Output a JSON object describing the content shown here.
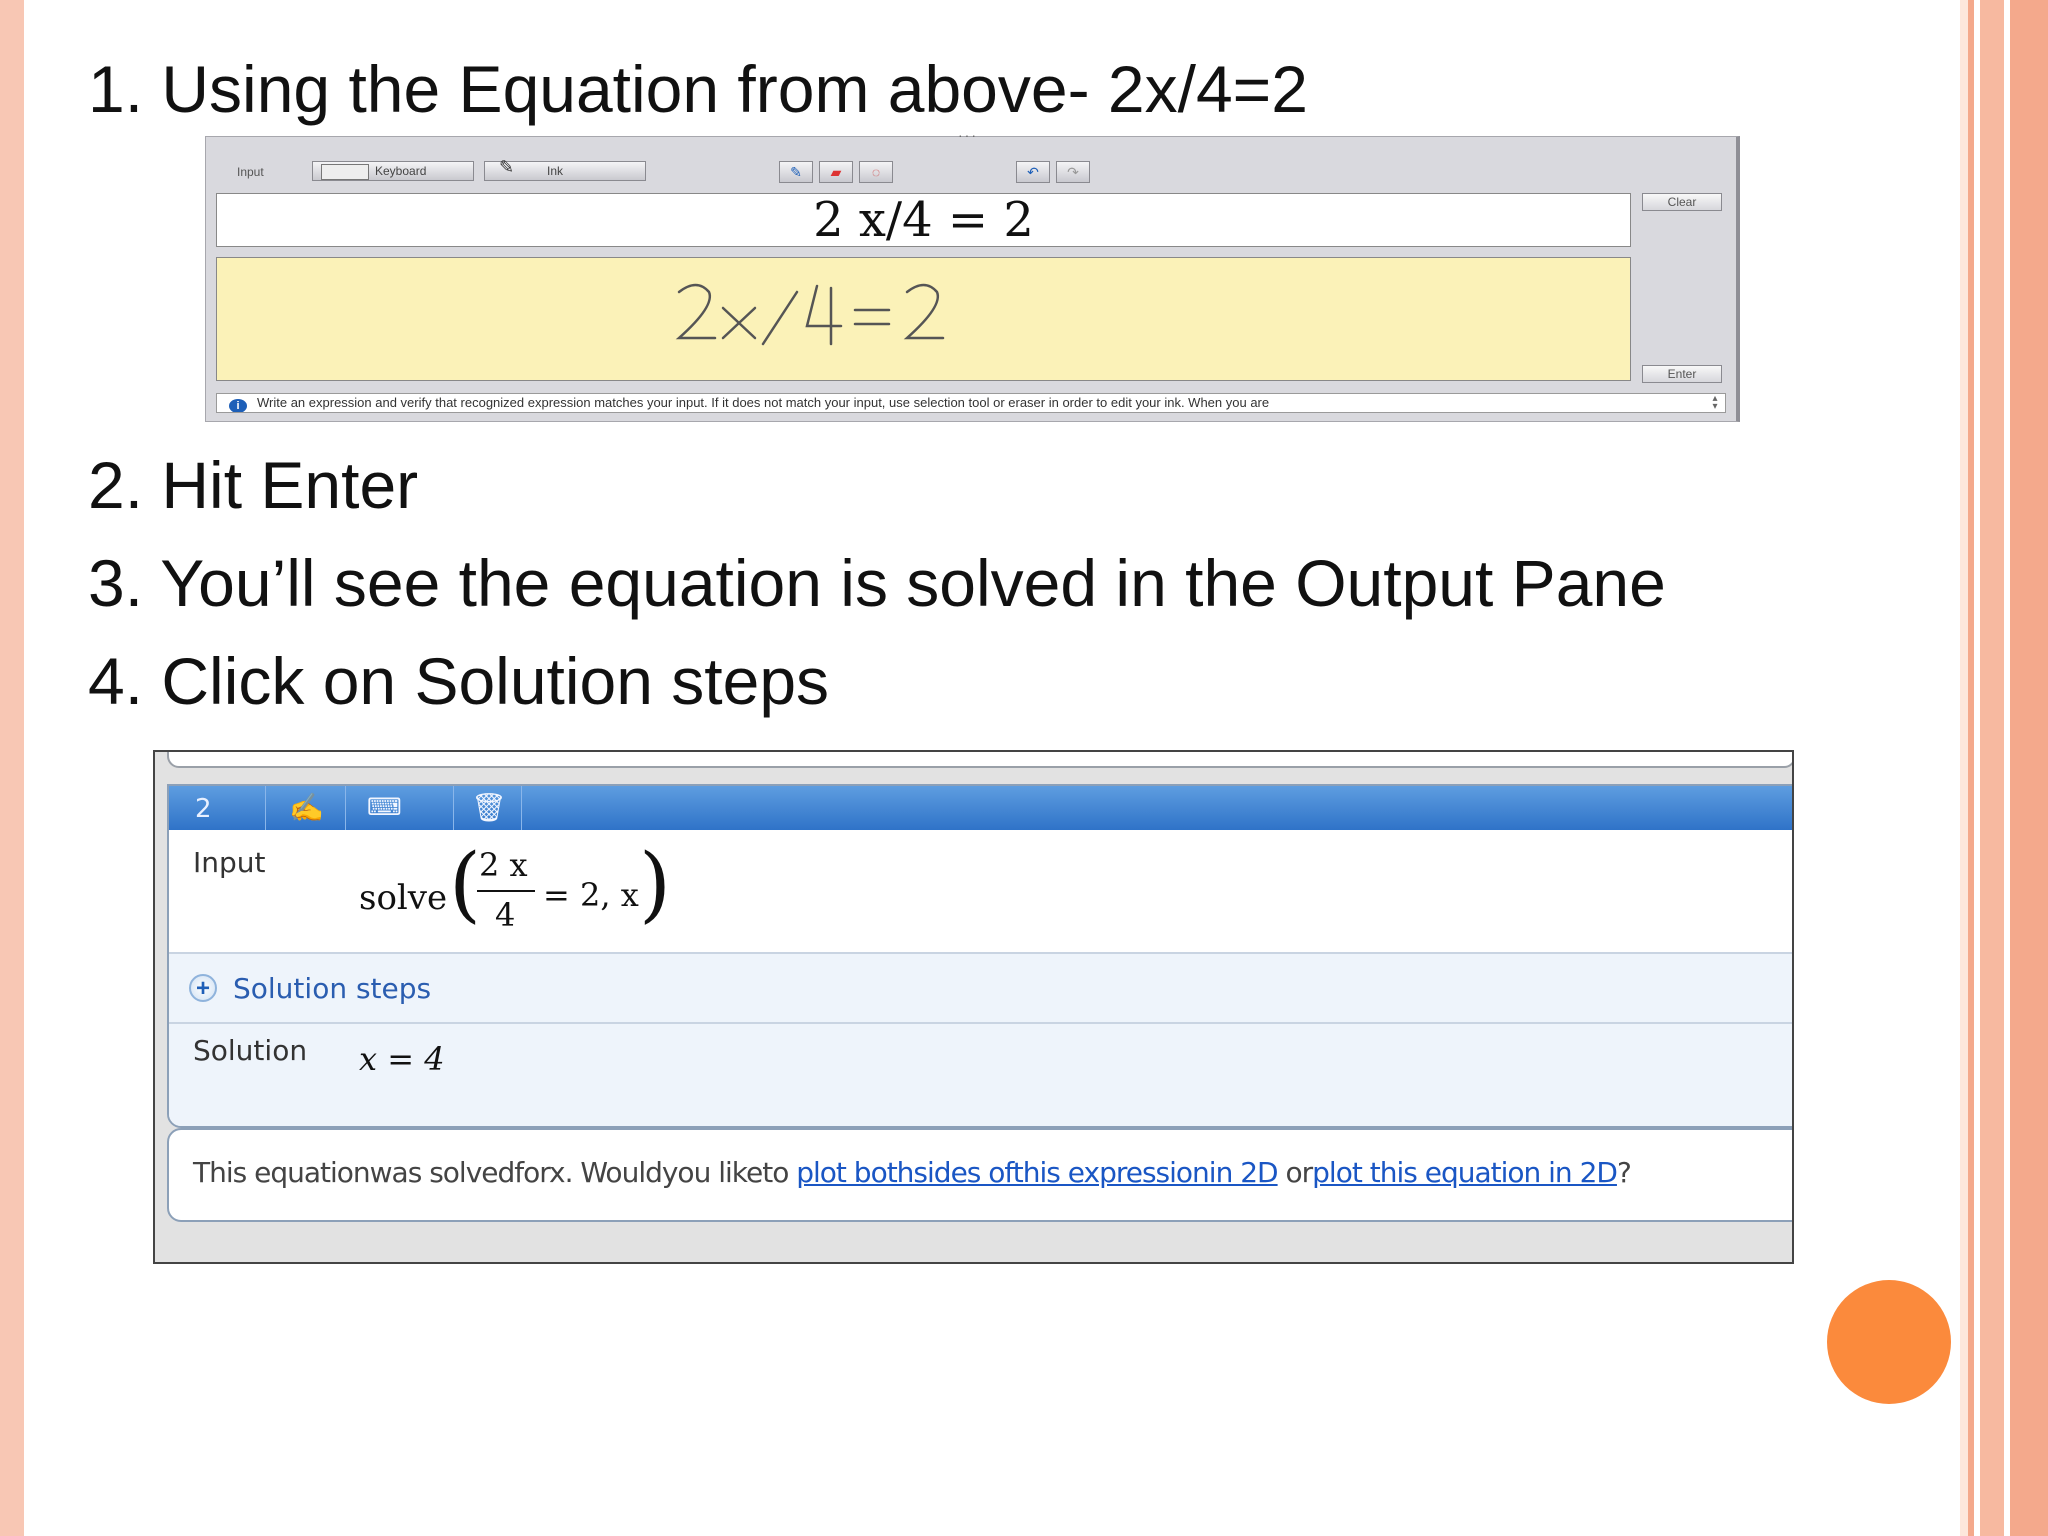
{
  "steps": {
    "s1": "1. Using the Equation from above- 2x/4=2",
    "s2": "2. Hit Enter",
    "s3": "3. You’ll see the equation is solved in the Output Pane",
    "s4": "4. Click on Solution steps"
  },
  "math_input_panel": {
    "input_label": "Input",
    "keyboard_label": "Keyboard",
    "ink_label": "Ink",
    "recognized_expression": "2 x/4 = 2",
    "clear_label": "Clear",
    "enter_label": "Enter",
    "status_text": "Write an expression and verify that recognized expression matches your input. If it does not match your input, use selection tool or eraser in order to edit your ink. When you are"
  },
  "output_pane": {
    "entry_number": "2",
    "input_label": "Input",
    "solve_word": "solve",
    "numerator": "2 x",
    "denominator": "4",
    "rhs": "= 2, x",
    "solution_steps_label": "Solution steps",
    "solution_label": "Solution",
    "solution_value": "x = 4",
    "message": {
      "prefix": "This equationwas solvedforx. Wouldyou liketo ",
      "link1": "plot bothsides ofthis expressionin 2D",
      "middle": " or",
      "link2": "plot this equation in 2D",
      "suffix": "?"
    }
  },
  "colors": {
    "accent_orange": "#fb8a3c",
    "header_blue": "#2f73c8",
    "link_blue": "#1a56c4",
    "ink_background": "#fbf2b8"
  }
}
